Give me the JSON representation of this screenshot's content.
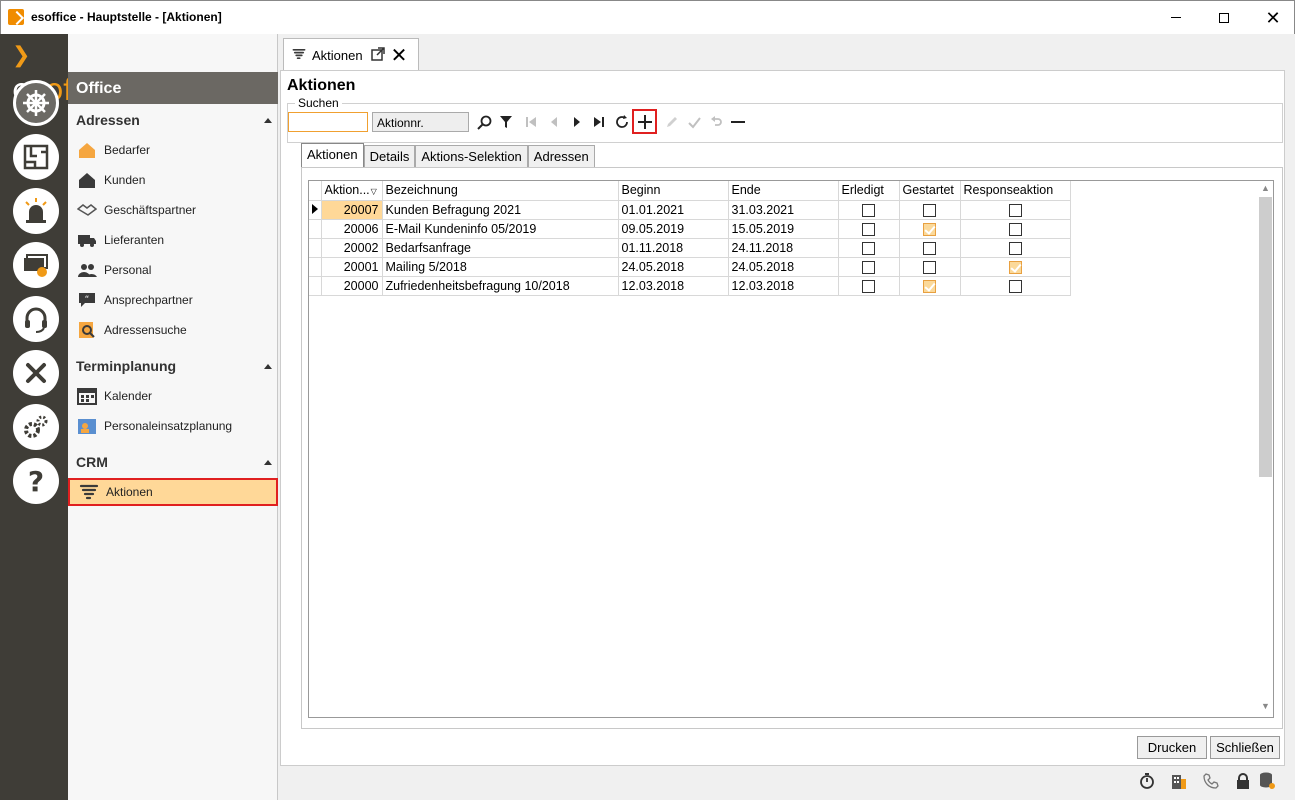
{
  "window": {
    "title": "esoffice - Hauptstelle - [Aktionen]"
  },
  "logo": {
    "part1": "es",
    "part2": "office"
  },
  "nav": {
    "header": "Office",
    "sections": [
      {
        "title": "Adressen",
        "items": [
          "Bedarfer",
          "Kunden",
          "Geschäftspartner",
          "Lieferanten",
          "Personal",
          "Ansprechpartner",
          "Adressensuche"
        ]
      },
      {
        "title": "Terminplanung",
        "items": [
          "Kalender",
          "Personaleinsatzplanung"
        ]
      },
      {
        "title": "CRM",
        "items": [
          "Aktionen"
        ]
      }
    ],
    "selected": "Aktionen"
  },
  "doc_tab": {
    "label": "Aktionen"
  },
  "page": {
    "title": "Aktionen",
    "search_legend": "Suchen",
    "search_value": "",
    "search_field": "Aktionnr."
  },
  "subtabs": [
    "Aktionen",
    "Details",
    "Aktions-Selektion",
    "Adressen"
  ],
  "grid": {
    "columns": [
      "Aktion...",
      "Bezeichnung",
      "Beginn",
      "Ende",
      "Erledigt",
      "Gestartet",
      "Responseaktion"
    ],
    "rows": [
      {
        "nr": "20007",
        "bez": "Kunden Befragung 2021",
        "beginn": "01.01.2021",
        "ende": "31.03.2021",
        "erledigt": false,
        "gestartet": false,
        "response": false
      },
      {
        "nr": "20006",
        "bez": "E-Mail Kundeninfo 05/2019",
        "beginn": "09.05.2019",
        "ende": "15.05.2019",
        "erledigt": false,
        "gestartet": true,
        "response": false
      },
      {
        "nr": "20002",
        "bez": "Bedarfsanfrage",
        "beginn": "01.11.2018",
        "ende": "24.11.2018",
        "erledigt": false,
        "gestartet": false,
        "response": false
      },
      {
        "nr": "20001",
        "bez": "Mailing 5/2018",
        "beginn": "24.05.2018",
        "ende": "24.05.2018",
        "erledigt": false,
        "gestartet": false,
        "response": true
      },
      {
        "nr": "20000",
        "bez": "Zufriedenheitsbefragung 10/2018",
        "beginn": "12.03.2018",
        "ende": "12.03.2018",
        "erledigt": false,
        "gestartet": true,
        "response": false
      }
    ]
  },
  "buttons": {
    "print": "Drucken",
    "close": "Schließen"
  },
  "colors": {
    "accent": "#f09a17",
    "rail": "#3f3d37",
    "selected": "#ffd898",
    "highlight_border": "#e02020"
  }
}
